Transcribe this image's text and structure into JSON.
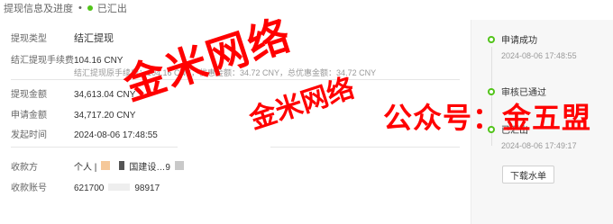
{
  "breadcrumb": {
    "page": "提现信息及进度",
    "status_label": "已汇出",
    "status_color": "#52c41a"
  },
  "details": {
    "type": {
      "label": "提现类型",
      "value": "结汇提现"
    },
    "fee": {
      "label": "结汇提现手续费",
      "value": "104.16 CNY",
      "note": "结汇提现原手续费：104.16 CNY，优惠金额：34.72 CNY，总优惠金额：34.72 CNY"
    },
    "amount": {
      "label": "提现金额",
      "value": "34,613.04 CNY"
    },
    "apply_amount": {
      "label": "申请金额",
      "value": "34,717.20 CNY"
    },
    "time": {
      "label": "发起时间",
      "value": "2024-08-06 17:48:55"
    },
    "payee": {
      "label": "收款方",
      "value_prefix": "个人 | ",
      "value_bank": "国建设…9"
    },
    "account": {
      "label": "收款账号",
      "value_prefix": "621700",
      "value_suffix": "98917"
    }
  },
  "timeline": [
    {
      "title": "申请成功",
      "time": "2024-08-06 17:48:55"
    },
    {
      "title": "审核已通过",
      "time": ""
    },
    {
      "title": "已汇出",
      "time": "2024-08-06 17:49:17"
    }
  ],
  "download_label": "下载水单",
  "watermarks": {
    "w1": "金米网络",
    "w2": "金米网络",
    "w3": "公众号：金五盟",
    "color": "#ff0000"
  }
}
